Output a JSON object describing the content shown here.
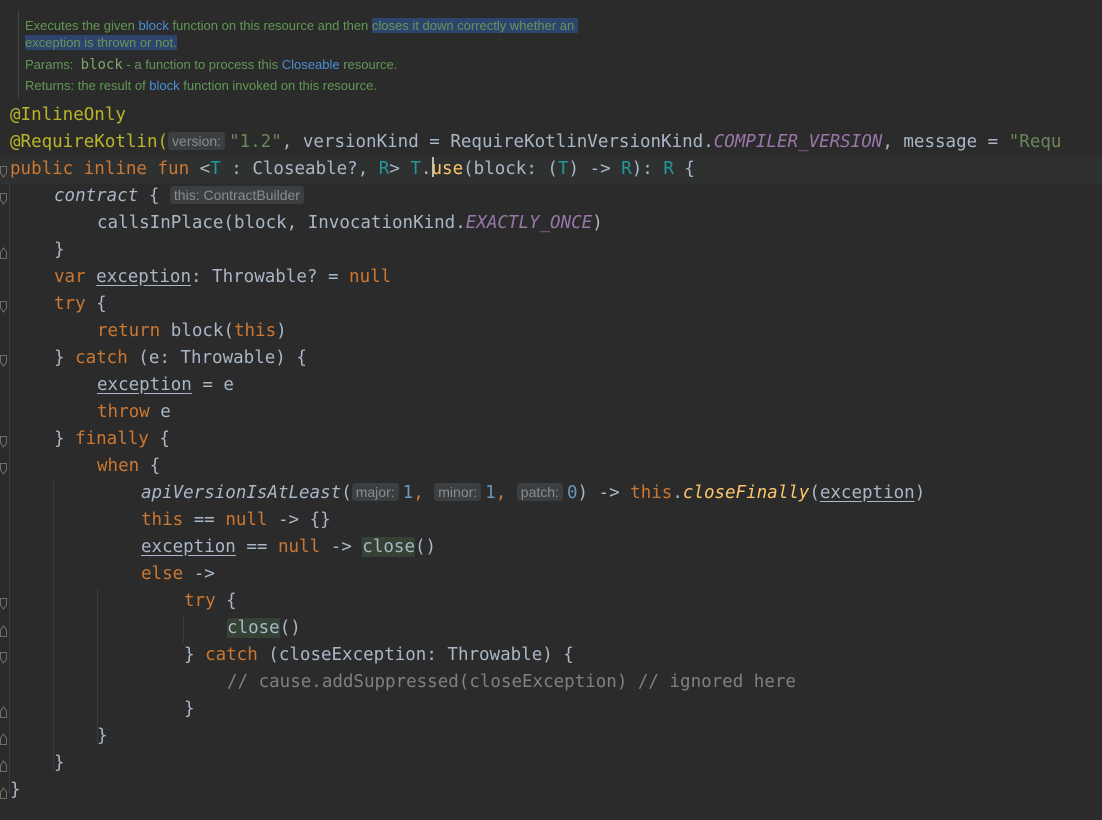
{
  "doc": {
    "line1_pre": "Executes the given ",
    "line1_link": "block",
    "line1_mid": " function on this resource and then ",
    "line1_sel": "closes it down correctly whether an ",
    "line2_sel": "exception is thrown or not.",
    "params_label": "Params: ",
    "params_name": "block",
    "params_mid": " - a function to process this ",
    "params_link": "Closeable",
    "params_end": " resource.",
    "returns_label": "Returns: ",
    "returns_pre": "the result of ",
    "returns_link": "block",
    "returns_end": " function invoked on this resource."
  },
  "code": {
    "ann1": "@InlineOnly",
    "ann2": "@RequireKotlin(",
    "hint_version": "version:",
    "ver_str": "\"1.2\"",
    "ann2_mid": ", versionKind = RequireKotlinVersionKind.",
    "ann2_const": "COMPILER_VERSION",
    "ann2_tail": ", message = ",
    "ann2_str": "\"Requ",
    "sig_kw": "public inline fun ",
    "sig_lt": "<",
    "sig_T": "T",
    "sig_mid": " : Closeable?, ",
    "sig_R": "R",
    "sig_gt": "> ",
    "sig_T2": "T",
    "sig_dot": ".",
    "sig_fn": "use",
    "sig_p1": "(block: (",
    "sig_T3": "T",
    "sig_p2": ") -> ",
    "sig_R2": "R",
    "sig_p3": "): ",
    "sig_R3": "R",
    "sig_end": " {",
    "contract": "contract",
    "contract_brace": " { ",
    "hint_this": "this: ContractBuilder",
    "calls_pre": "callsInPlace(block, InvocationKind.",
    "calls_const": "EXACTLY_ONCE",
    "calls_end": ")",
    "close_brace": "}",
    "var_kw": "var ",
    "var_name": "exception",
    "var_type": ": Throwable? = ",
    "var_null": "null",
    "try_kw": "try",
    "open_brace": " {",
    "return_kw": "return ",
    "return_call": "block(",
    "return_this": "this",
    "return_end": ")",
    "catch_pre": "} ",
    "catch_kw": "catch",
    "catch_args": " (e: Throwable) {",
    "assign_name": "exception",
    "assign_rest": " = e",
    "throw_kw": "throw",
    "throw_rest": " e",
    "finally_pre": "} ",
    "finally_kw": "finally",
    "when_kw": "when",
    "api_fn": "apiVersionIsAtLeast",
    "api_open": "(",
    "hint_major": "major:",
    "major_val": "1",
    "comma": ", ",
    "hint_minor": "minor:",
    "minor_val": "1",
    "hint_patch": "patch:",
    "patch_val": "0",
    "api_arrow": ") -> ",
    "api_this": "this",
    "api_dot": ".",
    "api_cf": "closeFinally",
    "api_paren_o": "(",
    "api_exc": "exception",
    "api_paren_c": ")",
    "this_kw": "this",
    "eq": " == ",
    "null_kw": "null",
    "arrow_empty": " -> {}",
    "exc_name": "exception",
    "arrow": " -> ",
    "close_call": "close",
    "parens": "()",
    "else_kw": "else",
    "else_arrow": " ->",
    "catch2_args": " (closeException: Throwable) {",
    "comment": "// cause.addSuppressed(closeException) // ignored here"
  }
}
